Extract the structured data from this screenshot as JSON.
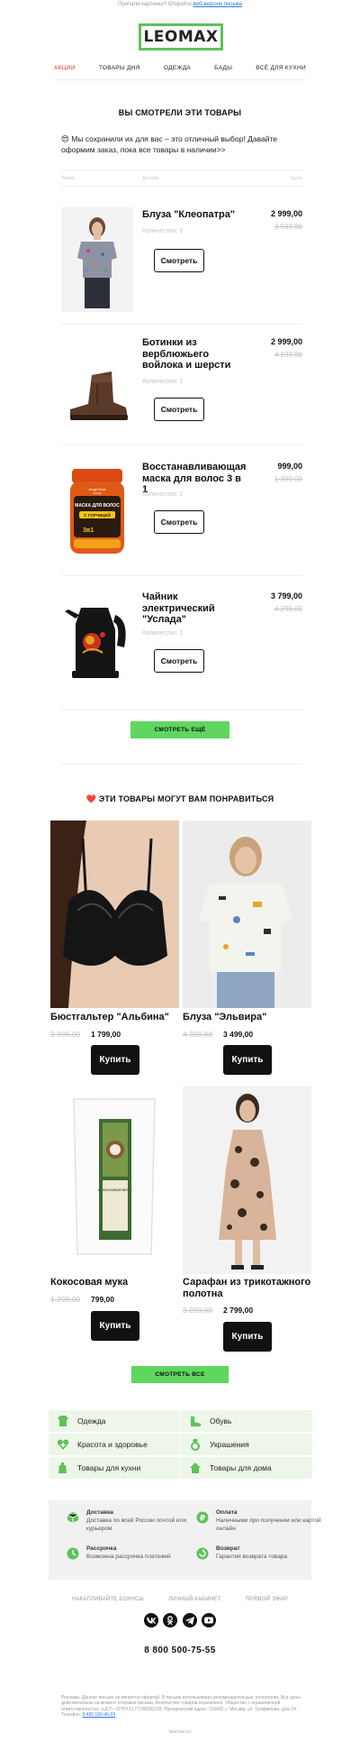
{
  "preheader": {
    "text": "Пропали картинки? Откройте",
    "link": "веб-версию письма"
  },
  "logo": {
    "text": "LEOMAX"
  },
  "nav": [
    "АКЦИИ",
    "ТОВАРЫ ДНЯ",
    "ОДЕЖДА",
    "БАДЫ",
    "ВСЁ ДЛЯ КУХНИ"
  ],
  "viewed": {
    "title": "ВЫ СМОТРЕЛИ ЭТИ ТОВАРЫ",
    "intro_emoji": "😍",
    "intro": "Мы сохранили их для вас – это отличный выбор! Давайте оформим заказ, пока все товары в наличии>>",
    "headers": {
      "product": "Товар",
      "details": "Детали",
      "price": "Цена"
    },
    "items": [
      {
        "name": "Блуза \"Клеопатра\"",
        "qty": "Количество: 1",
        "price": "2 999,00",
        "old_price": "3 599,00",
        "button": "Смотреть"
      },
      {
        "name": "Ботинки из верблюжьего войлока и шерсти",
        "qty": "Количество: 1",
        "price": "2 999,00",
        "old_price": "4 199,00",
        "button": "Смотреть"
      },
      {
        "name": "Восстанавливающая маска для волос 3 в 1",
        "qty": "Количество: 1",
        "price": "999,00",
        "old_price": "1 399,00",
        "button": "Смотреть"
      },
      {
        "name": "Чайник электрический \"Услада\"",
        "qty": "Количество: 1",
        "price": "3 799,00",
        "old_price": "4 299,00",
        "button": "Смотреть"
      }
    ],
    "more_button": "СМОТРЕТЬ ЕЩЁ"
  },
  "recommend": {
    "title_emoji": "❤️",
    "title": "ЭТИ ТОВАРЫ МОГУТ ВАМ ПОНРАВИТЬСЯ",
    "items": [
      {
        "name": "Бюстгальтер \"Альбина\"",
        "old_price": "2 999,00",
        "price": "1 799,00",
        "button": "Купить"
      },
      {
        "name": "Блуза \"Эльвира\"",
        "old_price": "4 399,00",
        "price": "3 499,00",
        "button": "Купить"
      },
      {
        "name": "Кокосовая мука",
        "old_price": "1 299,00",
        "price": "799,00",
        "button": "Купить"
      },
      {
        "name": "Сарафан из трикотажного полотна",
        "old_price": "3 299,00",
        "price": "2 799,00",
        "button": "Купить"
      }
    ],
    "all_button": "СМОТРЕТЬ ВСЕ",
    "jar_label_brand": "Angel Kiss",
    "jar_label_product": "МАСКА ДЛЯ ВОЛОС",
    "jar_label_variant": "С ГОРЧИЦЕЙ",
    "jar_label_code": "3в1",
    "jar_label_brand_sub": "cosmetic",
    "bag_label": "КОКОСОВАЯ МУКА"
  },
  "categories": [
    {
      "label": "Одежда",
      "icon": "shirt-icon"
    },
    {
      "label": "Обувь",
      "icon": "boot-icon"
    },
    {
      "label": "Красота и здоровье",
      "icon": "heart-plus-icon"
    },
    {
      "label": "Украшения",
      "icon": "ring-icon"
    },
    {
      "label": "Товары для кухни",
      "icon": "kettle-icon"
    },
    {
      "label": "Товары для дома",
      "icon": "house-icon"
    }
  ],
  "info": {
    "delivery": {
      "title": "Доставка",
      "text": "Доставка по всей России почтой или курьером"
    },
    "payment": {
      "title": "Оплата",
      "text": "Наличными при получении или картой онлайн"
    },
    "installment": {
      "title": "Рассрочка",
      "text": "Возможна рассрочка платежей"
    },
    "return": {
      "title": "Возврат",
      "text": "Гарантия возврата товара"
    }
  },
  "footer_links": [
    "НАКАПЛИВАЙТЕ БОНУСЫ",
    "ЛИЧНЫЙ КАБИНЕТ",
    "ПРЯМОЙ ЭФИР"
  ],
  "social": [
    "vk-icon",
    "ok-icon",
    "telegram-icon",
    "youtube-icon"
  ],
  "phone": "8 800 500-75-55",
  "legal": {
    "text": "Реклама. Данное письмо не является офертой. В письме использованы рекомендательные технологии. Все цены действительны на момент отправки письма. Количество товаров ограничено. Общество с ограниченной ответственностью «ЦСТ» ОГРН 5177746036128. Юридический адрес: 115432, г. Москва, ул. Трофимова, дом 24. Телефон:",
    "phone_link": "8 495 150-46-03"
  },
  "site": "leomax.ru",
  "colors": {
    "accent_green": "#5fd65f",
    "logo_green": "#5fc25a",
    "active_red": "#e0322a",
    "category_bg": "#eef6e9"
  }
}
